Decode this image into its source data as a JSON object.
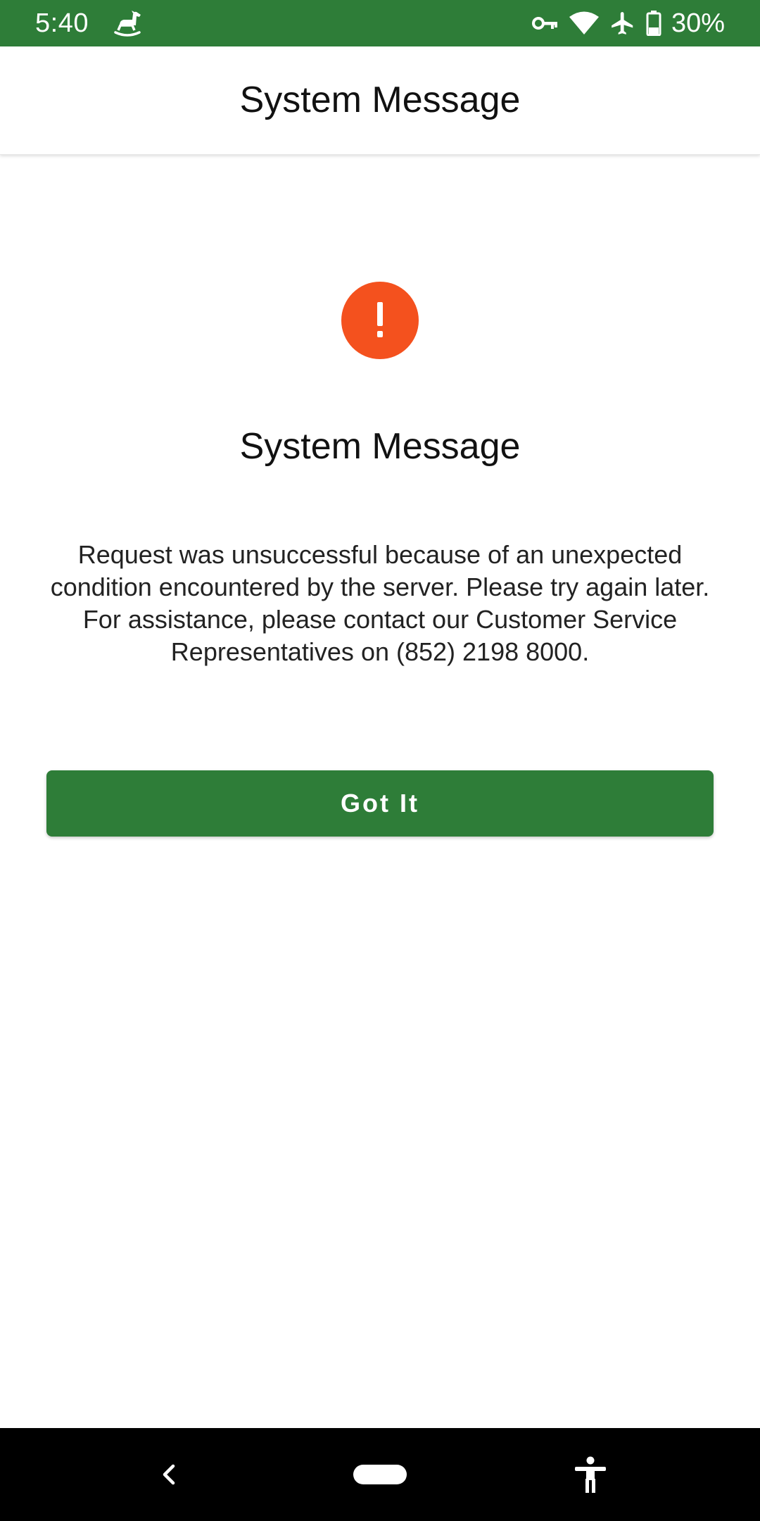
{
  "status_bar": {
    "time": "5:40",
    "battery": "30%",
    "icons": [
      "rocking-horse-icon",
      "vpn-key-icon",
      "wifi-icon",
      "airplane-mode-icon",
      "battery-icon"
    ],
    "background_color": "#2e7d38"
  },
  "app_bar": {
    "title": "System Message"
  },
  "message": {
    "icon": "exclamation-icon",
    "icon_color": "#f4511e",
    "title": "System Message",
    "body": "Request was unsuccessful because of an unexpected condition encountered by the server. Please try again later. For assistance, please contact our Customer Service Representatives on (852) 2198 8000."
  },
  "actions": {
    "got_it_label": "Got It",
    "button_color": "#2e7d38"
  },
  "nav_bar": {
    "icons": [
      "back-icon",
      "home-pill-icon",
      "accessibility-icon"
    ]
  }
}
